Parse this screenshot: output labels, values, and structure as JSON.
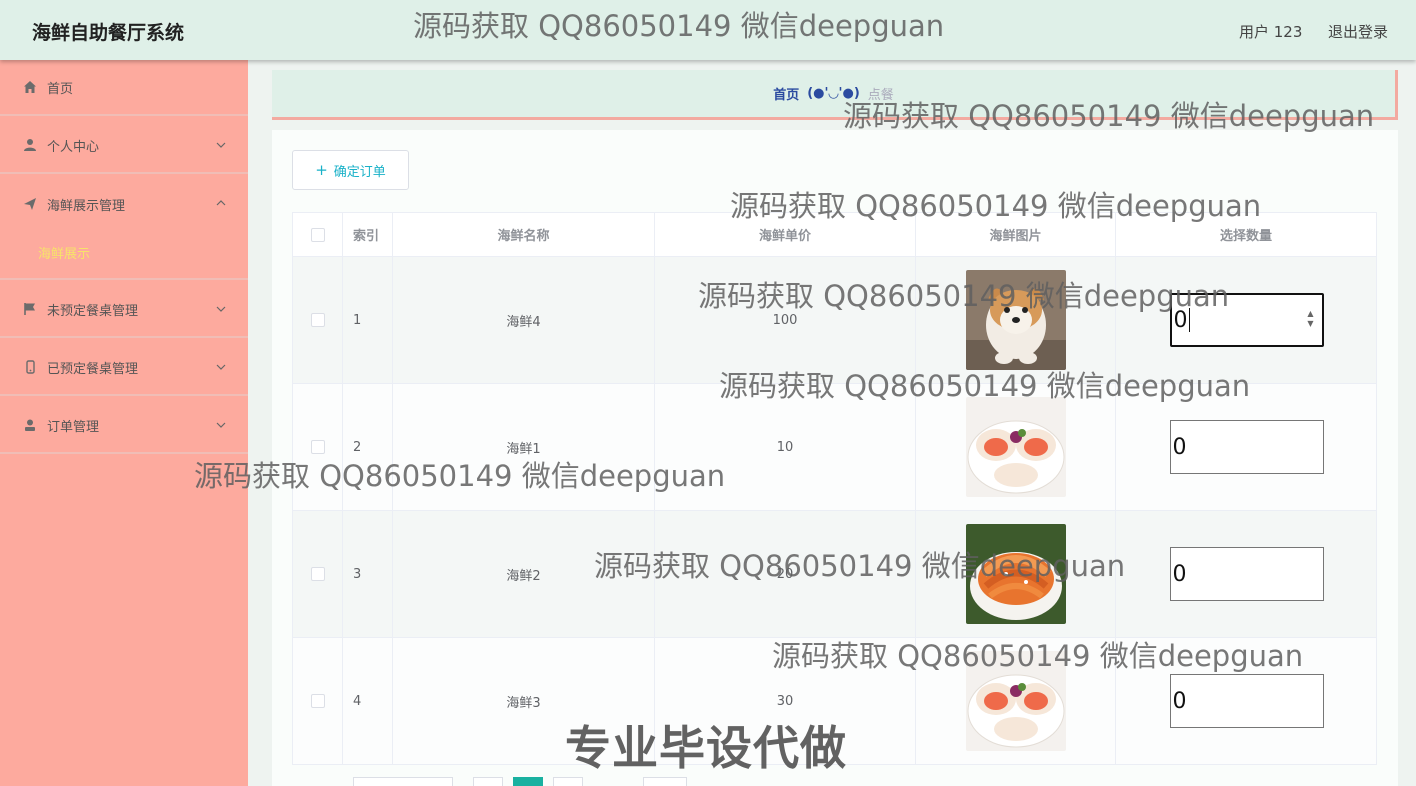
{
  "app": {
    "title": "海鲜自助餐厅系统"
  },
  "header": {
    "user": "用户 123",
    "logout": "退出登录"
  },
  "sidebar": {
    "items": [
      {
        "label": "首页",
        "icon": "home-icon"
      },
      {
        "label": "个人中心",
        "icon": "user-icon"
      },
      {
        "label": "海鲜展示管理",
        "icon": "send-icon",
        "expanded": true,
        "children": [
          {
            "label": "海鲜展示",
            "active": true
          }
        ]
      },
      {
        "label": "未预定餐桌管理",
        "icon": "flag-icon"
      },
      {
        "label": "已预定餐桌管理",
        "icon": "phone-icon"
      },
      {
        "label": "订单管理",
        "icon": "person-icon"
      }
    ]
  },
  "breadcrumb": {
    "home": "首页",
    "face": "(●'◡'●)",
    "current": "点餐"
  },
  "toolbar": {
    "confirm_label": "确定订单"
  },
  "table": {
    "headers": [
      "索引",
      "海鲜名称",
      "海鲜单价",
      "海鲜图片",
      "选择数量"
    ],
    "rows": [
      {
        "index": "1",
        "name": "海鲜4",
        "price": "100",
        "image": "dog-photo",
        "qty": "0"
      },
      {
        "index": "2",
        "name": "海鲜1",
        "price": "10",
        "image": "scallop-photo",
        "qty": "0"
      },
      {
        "index": "3",
        "name": "海鲜2",
        "price": "20",
        "image": "shrimp-photo",
        "qty": "0"
      },
      {
        "index": "4",
        "name": "海鲜3",
        "price": "30",
        "image": "scallop-photo",
        "qty": "0"
      }
    ]
  },
  "watermarks": {
    "text": "源码获取 QQ86050149 微信deepguan",
    "promo": "专业毕设代做"
  },
  "colors": {
    "header_bg": "#dff0e8",
    "sidebar_bg": "#fdaa9e",
    "active_menu": "#f7e36a",
    "accent": "#19b1c8"
  }
}
